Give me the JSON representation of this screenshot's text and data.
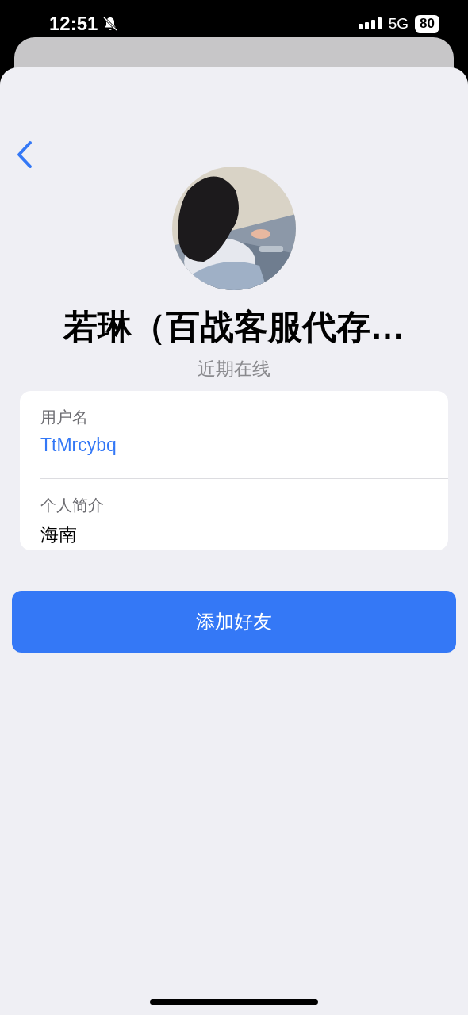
{
  "status_bar": {
    "time": "12:51",
    "network": "5G",
    "battery": "80"
  },
  "profile": {
    "name": "若琳（百战客服代存…",
    "status": "近期在线"
  },
  "info": [
    {
      "kind": "link",
      "label": "用户名",
      "value": "TtMrcybq"
    },
    {
      "kind": "text",
      "label": "个人简介",
      "value": "海南"
    }
  ],
  "add_button": "添加好友"
}
